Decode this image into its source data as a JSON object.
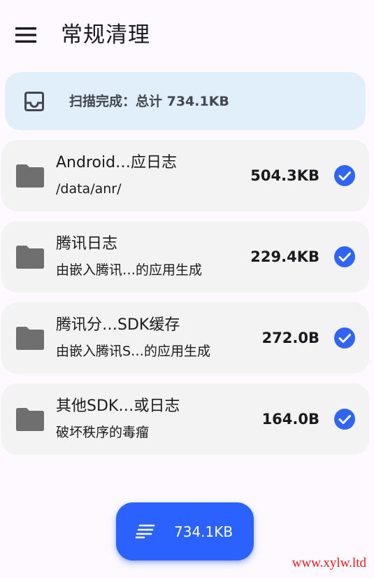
{
  "app_bar": {
    "title": "常规清理",
    "menu_icon": "menu-icon"
  },
  "summary": {
    "icon": "inbox-tray-icon",
    "text": "扫描完成：总计 734.1KB",
    "background": "#e1effa"
  },
  "items": [
    {
      "name": "Android…应日志",
      "subtitle": "/data/anr/",
      "size": "504.3KB",
      "checked": true
    },
    {
      "name": "腾讯日志",
      "subtitle": "由嵌入腾讯…的应用生成",
      "size": "229.4KB",
      "checked": true
    },
    {
      "name": "腾讯分…SDK缓存",
      "subtitle": "由嵌入腾讯S…的应用生成",
      "size": "272.0B",
      "checked": true
    },
    {
      "name": "其他SDK…或日志",
      "subtitle": "破坏秩序的毒瘤",
      "size": "164.0B",
      "checked": true
    }
  ],
  "fab": {
    "icon": "clean-sweep-icon",
    "label": "734.1KB",
    "color": "#2962ff"
  },
  "watermark": "www.xylw.ltd",
  "colors": {
    "accent": "#2962ff",
    "check": "#3064f5",
    "folder": "#6f6f6f",
    "card": "#f3f3f3",
    "watermark": "#e31b1b"
  }
}
